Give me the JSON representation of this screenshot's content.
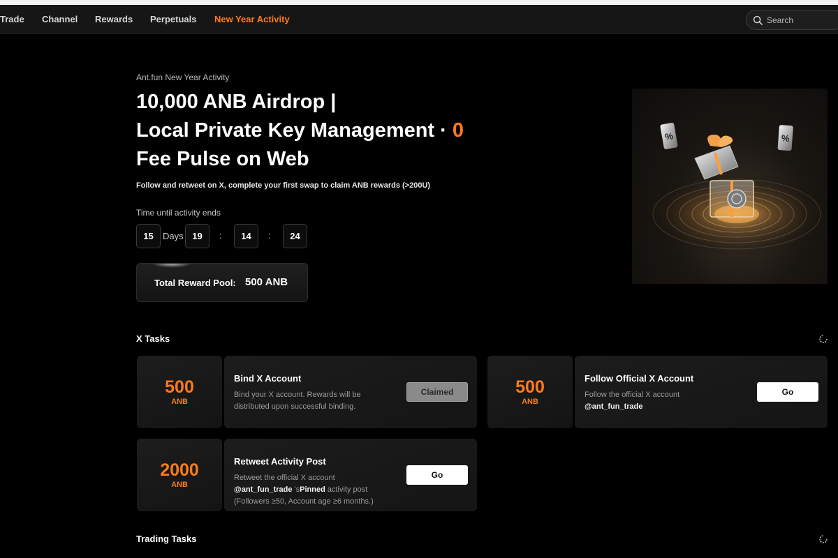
{
  "nav": {
    "items": [
      {
        "label": "Trade",
        "active": false
      },
      {
        "label": "Channel",
        "active": false
      },
      {
        "label": "Rewards",
        "active": false
      },
      {
        "label": "Perpetuals",
        "active": false
      },
      {
        "label": "New Year Activity",
        "active": true
      }
    ],
    "search_placeholder": "Search",
    "search_icon": "search-icon"
  },
  "hero": {
    "eyebrow": "Ant.fun New Year Activity",
    "headline_line1": "10,000 ANB Airdrop |",
    "headline_line2": "Local Private Key Management ·",
    "headline_accent": "0",
    "headline_line3": "Fee Pulse on Web",
    "subtitle": "Follow and retweet on X, complete your first swap to claim ANB rewards (>200U)",
    "timer": {
      "label": "Time until activity ends",
      "days": "15",
      "days_unit": "Days",
      "hours": "19",
      "minutes": "14",
      "seconds": "24",
      "separator": ":"
    },
    "pool": {
      "label": "Total Reward Pool:",
      "value": "500 ANB"
    }
  },
  "x_tasks": {
    "title": "X Tasks",
    "tasks": [
      {
        "amount": "500",
        "unit": "ANB",
        "title": "Bind X Account",
        "desc": "Bind your X account. Rewards will be distributed upon successful binding.",
        "button": "Claimed"
      },
      {
        "amount": "500",
        "unit": "ANB",
        "title": "Follow Official X Account",
        "desc_prefix": "Follow the official X account",
        "handle": "@ant_fun_trade",
        "button": "Go"
      },
      {
        "amount": "2000",
        "unit": "ANB",
        "title": "Retweet Activity Post",
        "desc_line1": "Retweet the official X account",
        "handle": "@ant_fun_trade",
        "desc_mid": "'s",
        "pinned": "Pinned",
        "desc_after": "activity post",
        "desc_line3": "(Followers ≥50, Account age ≥6 months.)",
        "button": "Go"
      }
    ]
  },
  "trading_tasks": {
    "title": "Trading Tasks"
  },
  "colors": {
    "accent": "#ff7a1a",
    "background": "#000000",
    "card": "#1a1a1a"
  }
}
